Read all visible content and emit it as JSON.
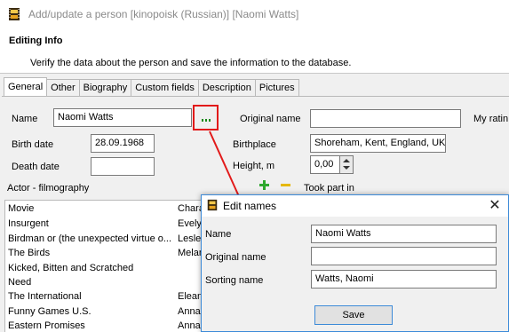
{
  "window": {
    "title": "Add/update a person [kinopoisk (Russian)] [Naomi Watts]"
  },
  "header": {
    "title": "Editing Info",
    "description": "Verify the data about the person and save the information to the database."
  },
  "tabs": [
    {
      "label": "General",
      "active": true
    },
    {
      "label": "Other"
    },
    {
      "label": "Biography"
    },
    {
      "label": "Custom fields"
    },
    {
      "label": "Description"
    },
    {
      "label": "Pictures"
    }
  ],
  "form": {
    "name_label": "Name",
    "name_value": "Naomi Watts",
    "original_name_label": "Original name",
    "original_name_value": "",
    "my_rating_label": "My ratin",
    "birth_date_label": "Birth date",
    "birth_date_value": "28.09.1968",
    "birthplace_label": "Birthplace",
    "birthplace_value": "Shoreham, Kent, England, UK",
    "death_date_label": "Death date",
    "death_date_value": "",
    "height_label": "Height, m",
    "height_value": "0,00"
  },
  "filmography": {
    "label": "Actor - filmography",
    "took_part_label": "Took part in",
    "columns": [
      "Movie",
      "Chara"
    ],
    "rows": [
      [
        "Insurgent",
        "Evely"
      ],
      [
        "Birdman or (the unexpected virtue o...",
        "Lesle"
      ],
      [
        "The Birds",
        "Melan"
      ],
      [
        "Kicked, Bitten and Scratched",
        ""
      ],
      [
        "Need",
        ""
      ],
      [
        "The International",
        "Elean"
      ],
      [
        "Funny Games U.S.",
        "Anna"
      ],
      [
        "Eastern Promises",
        "Anna"
      ]
    ]
  },
  "dialog": {
    "title": "Edit names",
    "close_glyph": "✕",
    "name_label": "Name",
    "name_value": "Naomi Watts",
    "original_name_label": "Original name",
    "original_name_value": "",
    "sorting_name_label": "Sorting name",
    "sorting_name_value": "Watts, Naomi",
    "save_label": "Save"
  },
  "colors": {
    "highlight": "#e21a1a",
    "dialog_border": "#3c8ad8",
    "add_green": "#2ea82e",
    "remove_yellow": "#e6b800"
  }
}
